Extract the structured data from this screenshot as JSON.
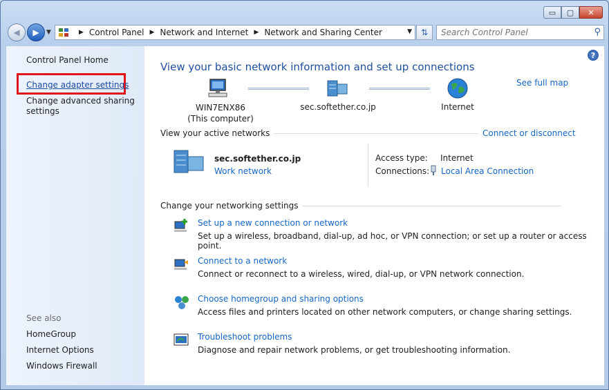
{
  "window": {
    "caption": {
      "minimize": "▭",
      "maximize": "▢",
      "close": "✕"
    }
  },
  "address": {
    "crumbs": [
      "Control Panel",
      "Network and Internet",
      "Network and Sharing Center"
    ],
    "search_placeholder": "Search Control Panel"
  },
  "left_pane": {
    "home": "Control Panel Home",
    "adapter": "Change adapter settings",
    "advanced_line1": "Change advanced sharing",
    "advanced_line2": "settings",
    "see_also": "See also",
    "homegroup": "HomeGroup",
    "internet_options": "Internet Options",
    "firewall": "Windows Firewall"
  },
  "main": {
    "title": "View your basic network information and set up connections",
    "see_full_map": "See full map",
    "map": {
      "computer_name": "WIN7ENX86",
      "computer_sub": "(This computer)",
      "network": "sec.softether.co.jp",
      "internet": "Internet"
    },
    "active_networks_label": "View your active networks",
    "connect_disconnect": "Connect or disconnect",
    "active": {
      "name": "sec.softether.co.jp",
      "type": "Work network",
      "access_label": "Access type:",
      "access_value": "Internet",
      "connections_label": "Connections:",
      "connections_value": "Local Area Connection"
    },
    "change_settings_label": "Change your networking settings",
    "tasks": [
      {
        "title": "Set up a new connection or network",
        "desc": "Set up a wireless, broadband, dial-up, ad hoc, or VPN connection; or set up a router or access point."
      },
      {
        "title": "Connect to a network",
        "desc": "Connect or reconnect to a wireless, wired, dial-up, or VPN network connection."
      },
      {
        "title": "Choose homegroup and sharing options",
        "desc": "Access files and printers located on other network computers, or change sharing settings."
      },
      {
        "title": "Troubleshoot problems",
        "desc": "Diagnose and repair network problems, or get troubleshooting information."
      }
    ]
  }
}
